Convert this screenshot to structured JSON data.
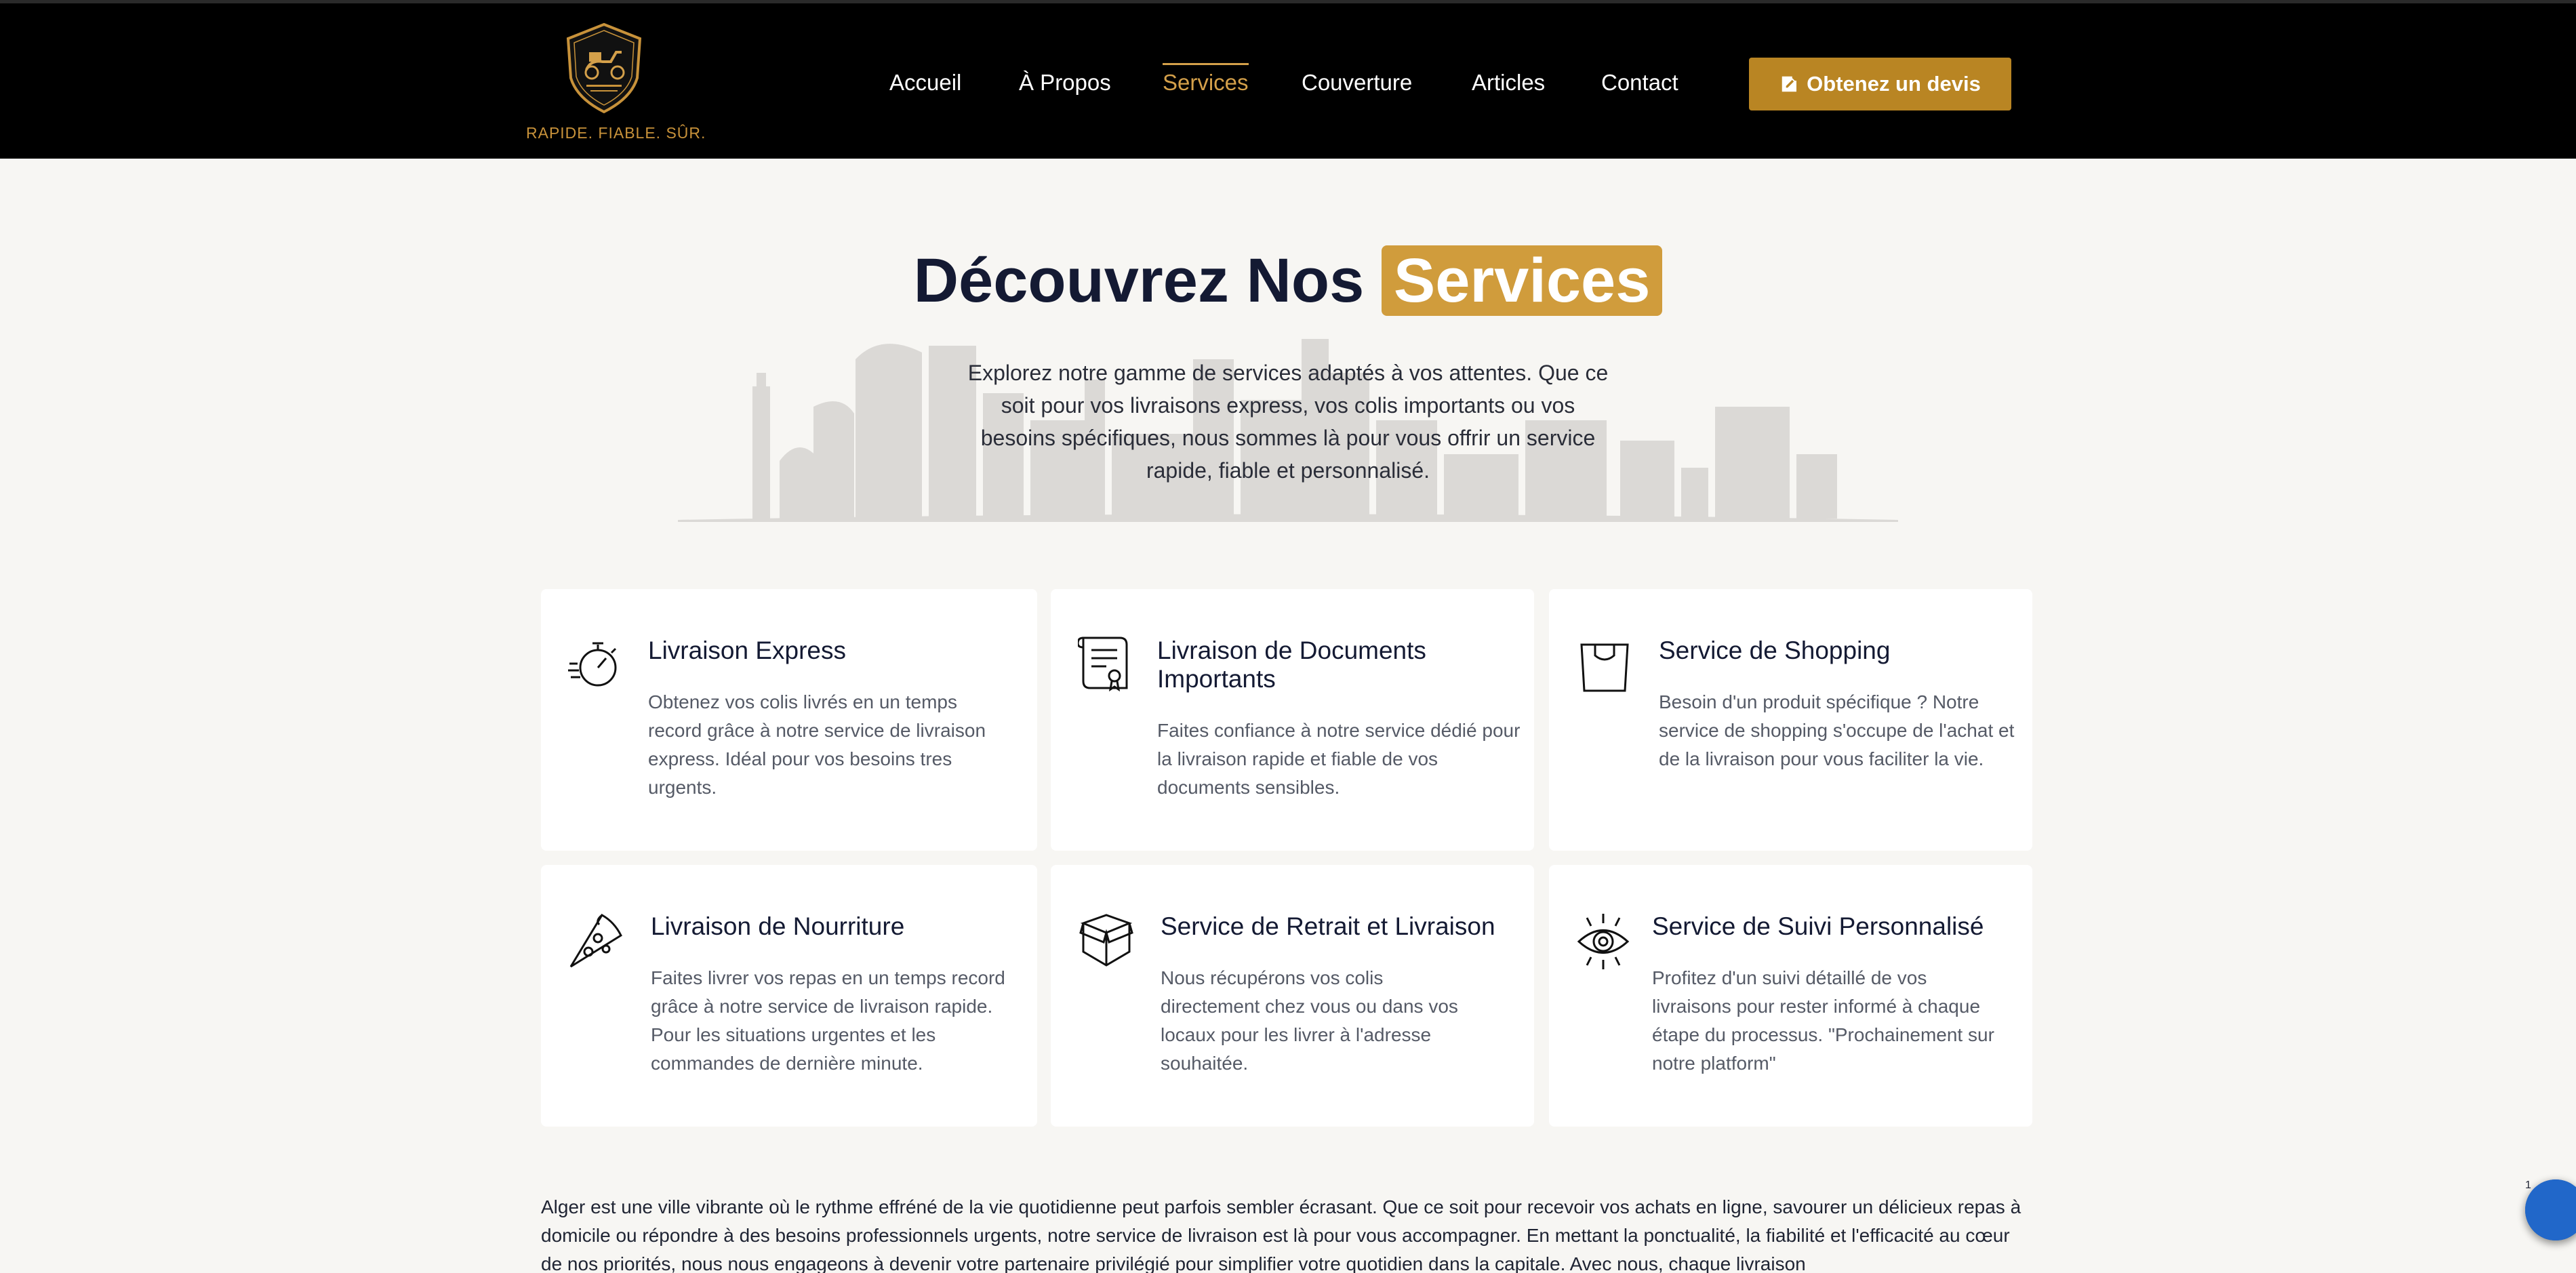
{
  "header": {
    "tagline": "RAPIDE. FIABLE. SÛR.",
    "nav": [
      "Accueil",
      "À Propos",
      "Services",
      "Couverture",
      "Articles",
      "Contact"
    ],
    "cta_label": "Obtenez un devis"
  },
  "hero": {
    "title_plain": "Découvrez Nos",
    "title_highlight": "Services",
    "description": "Explorez notre gamme de services adaptés à vos attentes. Que ce soit pour vos livraisons express, vos colis importants ou vos besoins spécifiques, nous sommes là pour vous offrir un service rapide, fiable et personnalisé."
  },
  "services": [
    {
      "title": "Livraison Express",
      "description": "Obtenez vos colis livrés en un temps record grâce à notre service de livraison express. Idéal pour vos besoins tres urgents.",
      "icon": "stopwatch-icon"
    },
    {
      "title": "Livraison de Documents Importants",
      "description": "Faites confiance à notre service dédié pour la livraison rapide et fiable de vos documents sensibles.",
      "icon": "document-icon"
    },
    {
      "title": "Service de Shopping",
      "description": "Besoin d'un produit spécifique ? Notre service de shopping s'occupe de l'achat et de la livraison pour vous faciliter la vie.",
      "icon": "shopping-bag-icon"
    },
    {
      "title": "Livraison de Nourriture",
      "description": "Faites livrer vos repas en un temps record grâce à notre service de livraison rapide. Pour les situations urgentes et les commandes de dernière minute.",
      "icon": "pizza-icon"
    },
    {
      "title": "Service de Retrait et Livraison",
      "description": "Nous récupérons vos colis directement chez vous ou dans vos locaux pour les livrer à l'adresse souhaitée.",
      "icon": "box-icon"
    },
    {
      "title": "Service de Suivi Personnalisé",
      "description": "Profitez d'un suivi détaillé de vos livraisons pour rester informé à chaque étape du processus. \"Prochainement sur notre platform\"",
      "icon": "eye-icon"
    }
  ],
  "about_text": "Alger est une ville vibrante où le rythme effréné de la vie quotidienne peut parfois sembler écrasant. Que ce soit pour recevoir vos achats en ligne, savourer un délicieux repas à domicile ou répondre à des besoins professionnels urgents, notre service de livraison est là pour vous accompagner. En mettant la ponctualité, la fiabilité et l'efficacité au cœur de nos priorités, nous nous engageons à devenir votre partenaire privilégié pour simplifier votre quotidien dans la capitale. Avec nous, chaque livraison",
  "chat": {
    "badge": "1"
  },
  "colors": {
    "accent": "#d09c3c",
    "cta": "#b98523",
    "nav_active": "#d4a04a",
    "header_bg": "#000000",
    "chat": "#2167c9"
  }
}
